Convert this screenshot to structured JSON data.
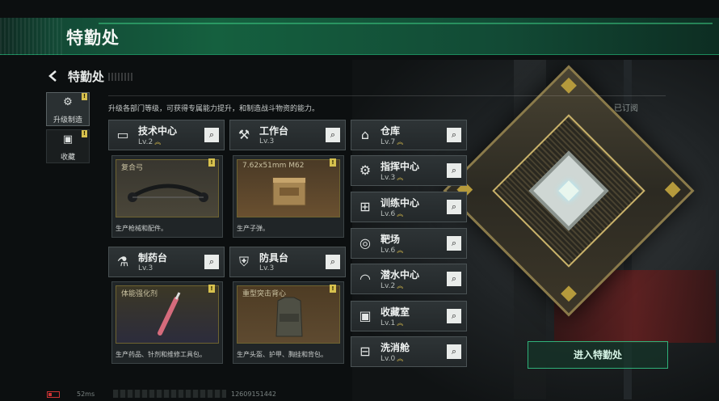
{
  "banner": {
    "title": "特勤处"
  },
  "header": {
    "title": "特勤处",
    "description": "升级各部门等级，可获得专属能力提升，和制造战斗物资的能力。",
    "subscribed": "已订阅"
  },
  "side_tabs": [
    {
      "label": "升级制造",
      "icon": "upgrade-icon",
      "active": true
    },
    {
      "label": "收藏",
      "icon": "collection-icon",
      "active": false
    }
  ],
  "facilities_left": [
    {
      "name": "技术中心",
      "level": "Lv.2",
      "icon": "monitor-icon"
    },
    {
      "name": "工作台",
      "level": "Lv.3",
      "icon": "tools-icon"
    },
    {
      "name": "制药台",
      "level": "Lv.3",
      "icon": "pharmacy-icon"
    },
    {
      "name": "防具台",
      "level": "Lv.3",
      "icon": "armor-icon"
    }
  ],
  "products": [
    {
      "name": "复合弓",
      "desc": "生产枪械和配件。"
    },
    {
      "name": "7.62x51mm M62",
      "desc": "生产子弹。"
    },
    {
      "name": "体能强化剂",
      "desc": "生产药品、针剂和维修工具包。"
    },
    {
      "name": "重型突击背心",
      "desc": "生产头盔、护甲、胸挂和背包。"
    }
  ],
  "facilities_right": [
    {
      "name": "仓库",
      "level": "Lv.7",
      "icon": "warehouse-icon"
    },
    {
      "name": "指挥中心",
      "level": "Lv.3",
      "icon": "command-icon"
    },
    {
      "name": "训练中心",
      "level": "Lv.6",
      "icon": "dumbbell-icon"
    },
    {
      "name": "靶场",
      "level": "Lv.6",
      "icon": "target-icon"
    },
    {
      "name": "潜水中心",
      "level": "Lv.2",
      "icon": "diving-icon"
    },
    {
      "name": "收藏室",
      "level": "Lv.1",
      "icon": "collection-room-icon"
    },
    {
      "name": "洗消舱",
      "level": "Lv.0",
      "icon": "decontamination-icon"
    }
  ],
  "enter_button": "进入特勤处",
  "footer": {
    "ping": "52ms",
    "uid": "12609151442"
  },
  "colors": {
    "accent": "#2fb27a",
    "gold": "#d7c14e"
  }
}
